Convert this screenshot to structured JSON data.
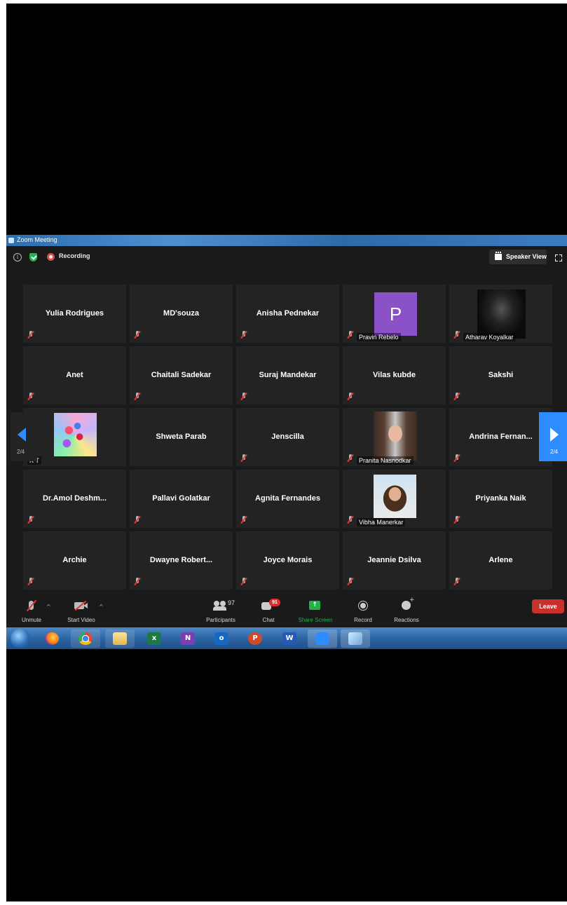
{
  "window": {
    "title": "Zoom Meeting"
  },
  "topbar": {
    "recording_label": "Recording",
    "speaker_view_label": "Speaker View"
  },
  "participants": [
    {
      "name": "Yulia Rodrigues"
    },
    {
      "name": "MD'souza"
    },
    {
      "name": "Anisha Pednekar"
    },
    {
      "name": "Pravin Rebelo",
      "avatar_letter": "P",
      "avatar_color": "#8a52c6"
    },
    {
      "name": "Atharav Koyalkar"
    },
    {
      "name": "Anet"
    },
    {
      "name": "Chaitali Sadekar"
    },
    {
      "name": "Suraj Mandekar"
    },
    {
      "name": "Vilas kubde"
    },
    {
      "name": "Sakshi"
    },
    {
      "name": "K T"
    },
    {
      "name": "Shweta Parab"
    },
    {
      "name": "Jenscilla"
    },
    {
      "name": "Pranita Nasnodkar"
    },
    {
      "name": "Andrina  Fernan..."
    },
    {
      "name": "Dr.Amol  Deshm..."
    },
    {
      "name": "Pallavi Golatkar"
    },
    {
      "name": "Agnita Fernandes"
    },
    {
      "name": "Vibha Manerkar"
    },
    {
      "name": "Priyanka Naik"
    },
    {
      "name": "Archie"
    },
    {
      "name": "Dwayne  Robert..."
    },
    {
      "name": "Joyce Morais"
    },
    {
      "name": "Jeannie Dsilva"
    },
    {
      "name": "Arlene"
    }
  ],
  "pagination": {
    "left": "2/4",
    "right": "2/4"
  },
  "toolbar": {
    "unmute": "Unmute",
    "start_video": "Start Video",
    "participants": "Participants",
    "participants_count": "97",
    "chat": "Chat",
    "chat_badge": "91",
    "share_screen": "Share Screen",
    "record": "Record",
    "reactions": "Reactions",
    "leave": "Leave"
  },
  "colors": {
    "accent": "#2d8cff",
    "leave": "#c8312b",
    "share": "#23b14d"
  },
  "taskbar": {
    "items": [
      "start-orb",
      "firefox-icon",
      "chrome-icon",
      "file-explorer-icon",
      "excel-icon",
      "onenote-icon",
      "outlook-icon",
      "powerpoint-icon",
      "word-icon",
      "zoom-icon",
      "window-icon"
    ]
  }
}
